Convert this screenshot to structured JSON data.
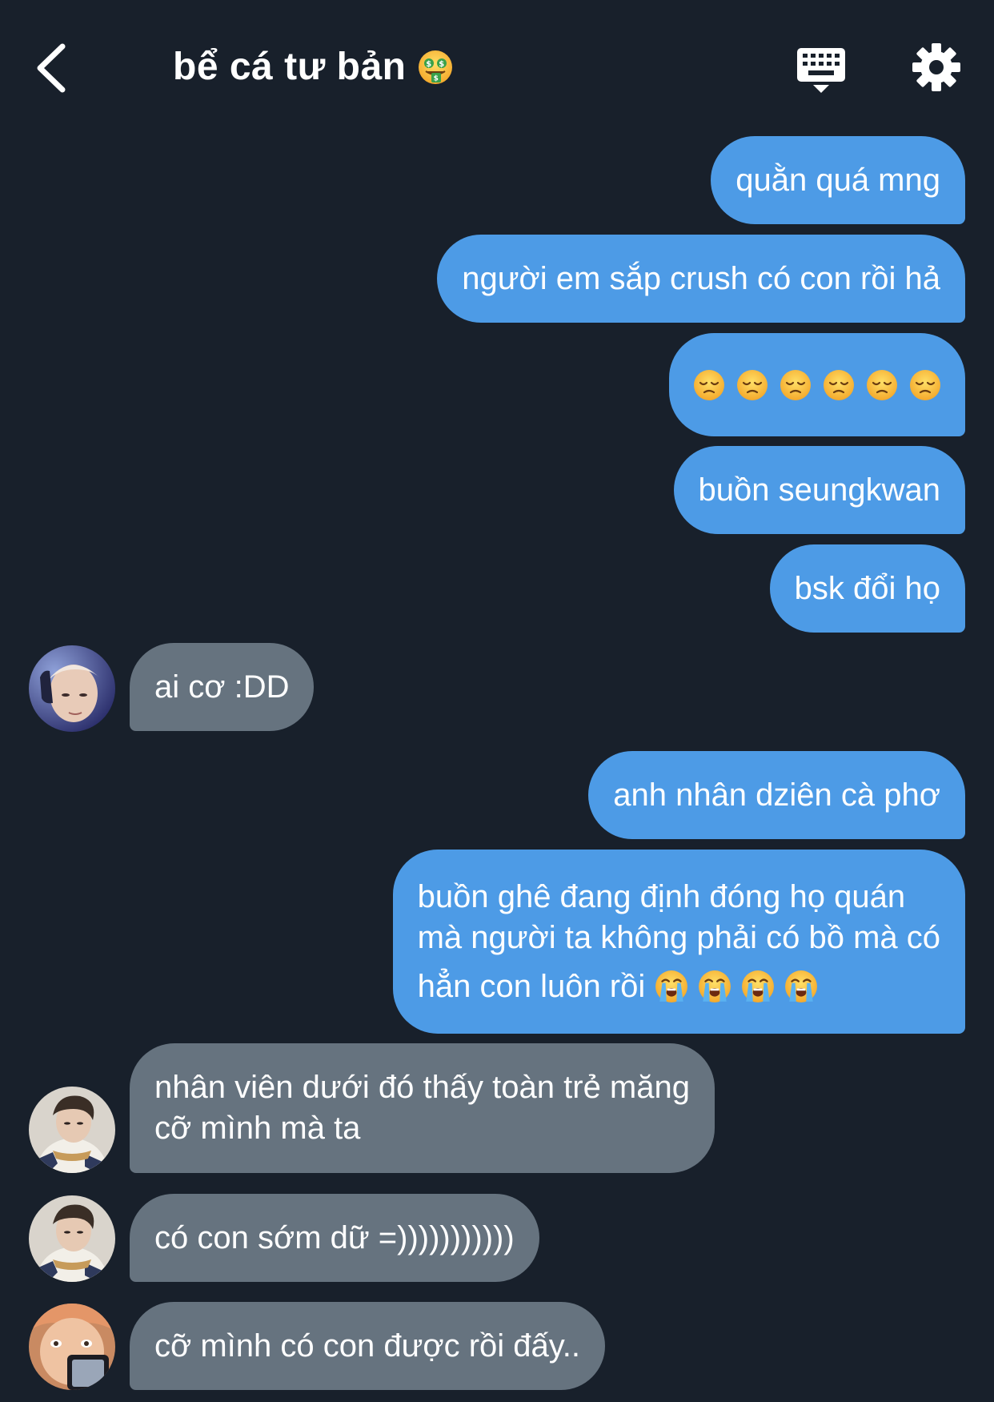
{
  "header": {
    "title": "bể cá tư bản",
    "title_emoji": "money-mouth-face",
    "back_icon": "chevron-left-icon",
    "keyboard_icon": "keyboard-icon",
    "settings_icon": "gear-icon"
  },
  "colors": {
    "background": "#18202b",
    "outgoing_bubble": "#4d9be6",
    "incoming_bubble": "#66737f",
    "text": "#ffffff"
  },
  "messages": [
    {
      "direction": "outgoing",
      "text": "quằn quá mng"
    },
    {
      "direction": "outgoing",
      "text": "người em sắp crush có con rồi hả"
    },
    {
      "direction": "outgoing",
      "emoji": "pensive-face",
      "emoji_count": 6
    },
    {
      "direction": "outgoing",
      "text": "buồn seungkwan"
    },
    {
      "direction": "outgoing",
      "text": "bsk đổi họ"
    },
    {
      "direction": "incoming",
      "text": "ai cơ :DD",
      "avatar": "avatar-1"
    },
    {
      "direction": "outgoing",
      "text": "anh nhân dziên cà phơ"
    },
    {
      "direction": "outgoing",
      "lines": [
        "buồn ghê đang định đóng họ quán",
        "mà người ta không phải có bồ mà có",
        "hẳn con luôn rồi"
      ],
      "trailing_emoji": "loudly-crying-face",
      "trailing_emoji_count": 4
    },
    {
      "direction": "incoming",
      "lines": [
        "nhân viên dưới đó thấy toàn trẻ măng",
        "cỡ mình mà ta"
      ],
      "avatar": "avatar-2"
    },
    {
      "direction": "incoming",
      "text": "có con sớm dữ =)))))))))))",
      "avatar": "avatar-2"
    },
    {
      "direction": "incoming",
      "text": "cỡ mình có con được rồi đấy..",
      "avatar": "avatar-3"
    }
  ]
}
